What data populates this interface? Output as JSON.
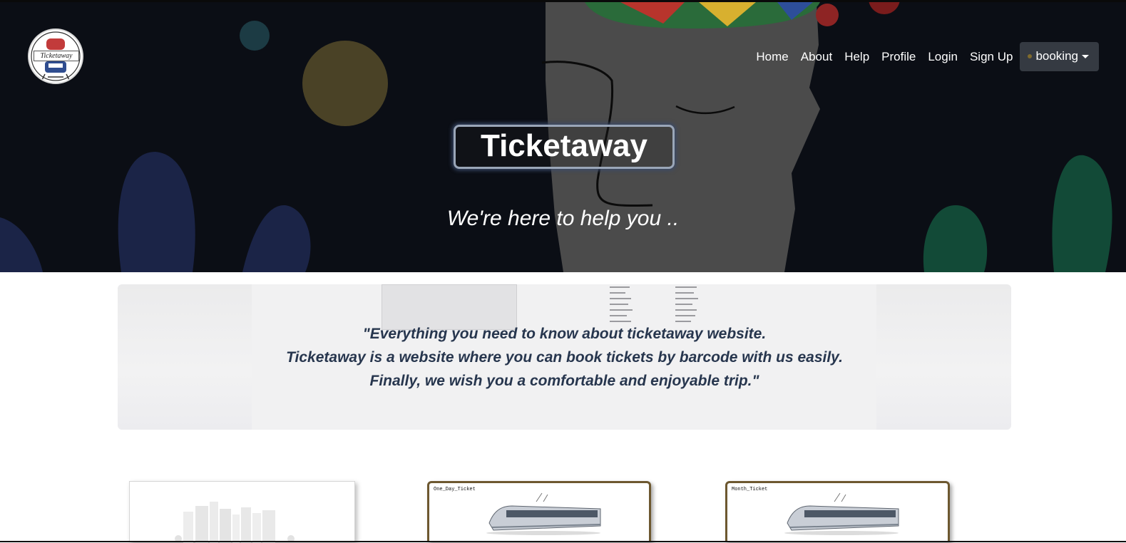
{
  "brand": {
    "logo_text": "Ticketaway"
  },
  "nav": {
    "items": [
      {
        "label": "Home"
      },
      {
        "label": "About"
      },
      {
        "label": "Help"
      },
      {
        "label": "Profile"
      },
      {
        "label": "Login"
      },
      {
        "label": "Sign Up"
      }
    ],
    "dropdown_label": "booking"
  },
  "hero": {
    "title": "Ticketaway",
    "subtitle": "We're here to help you .."
  },
  "about_quote": {
    "lines": [
      "\"Everything you need to know about ticketaway website.",
      "Ticketaway is a website where you can book tickets by barcode with us easily.",
      "Finally, we wish you a comfortable and enjoyable trip.\""
    ]
  },
  "tickets": [
    {
      "label": ""
    },
    {
      "label": "One_Day_Ticket"
    },
    {
      "label": "Month_Ticket"
    }
  ],
  "colors": {
    "hero_background": "#0b0e15",
    "quote_text": "#27364e",
    "card_border": "#6d5830",
    "dropdown_background": "#353a42"
  }
}
